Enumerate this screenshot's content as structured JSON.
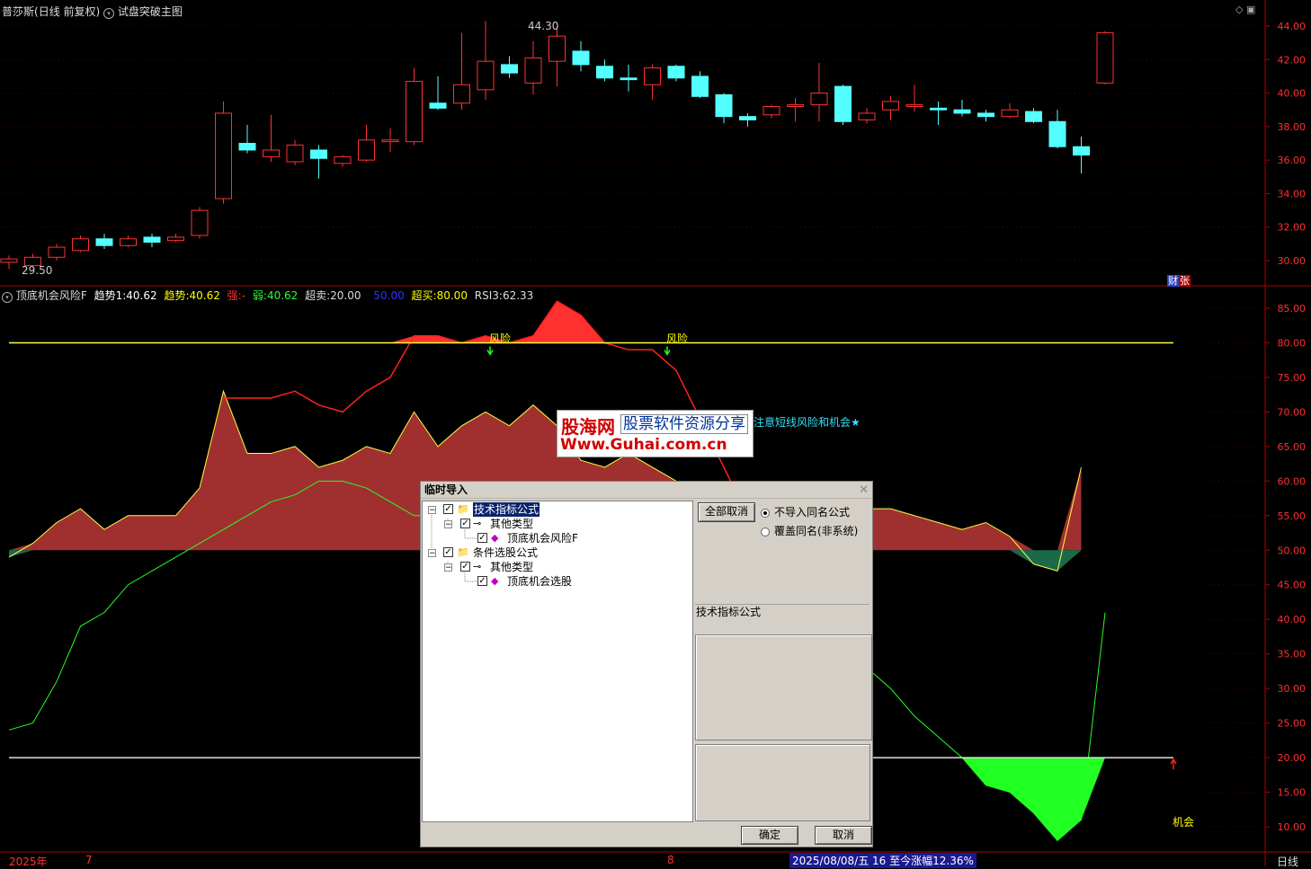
{
  "header": {
    "stock_name": "普莎斯",
    "mode": "(日线 前复权)",
    "main_indicator": "试盘突破主图"
  },
  "price_panel": {
    "high_label": "44.30",
    "low_label": "29.50",
    "yaxis_ticks": [
      "44.00",
      "42.00",
      "40.00",
      "38.00",
      "36.00",
      "34.00",
      "32.00",
      "30.00"
    ],
    "badge_left": "财",
    "badge_right": "张"
  },
  "indicator_panel": {
    "name": "顶底机会风险F",
    "trend1_label": "趋势1:",
    "trend1_value": "40.62",
    "trend_label": "趋势:",
    "trend_value": "40.62",
    "strong_label": "强:",
    "strong_value": "-",
    "weak_label": "弱:",
    "weak_value": "40.62",
    "oversold_label": "超卖:",
    "oversold_value": "20.00",
    "mid_value": "50.00",
    "overbought_label": "超买:",
    "overbought_value": "80.00",
    "rsi_label": "RSI3:",
    "rsi_value": "62.33",
    "risk_label_1": "风险",
    "risk_label_2": "风险",
    "note": "注意短线风险和机会★",
    "chance_label": "机会",
    "yaxis_ticks": [
      "85.00",
      "80.00",
      "75.00",
      "70.00",
      "65.00",
      "60.00",
      "55.00",
      "50.00",
      "45.00",
      "40.00",
      "35.00",
      "30.00",
      "25.00",
      "20.00",
      "15.00",
      "10.00"
    ]
  },
  "bottom_bar": {
    "year": "2025年",
    "mark_7": "7",
    "mark_8": "8",
    "status": "2025/08/08/五 16 至今涨幅12.36%",
    "period": "日线"
  },
  "watermark": {
    "line1": "股海网",
    "line2": "股票软件资源分享",
    "line3": "Www.Guhai.com.cn"
  },
  "dialog": {
    "title": "临时导入",
    "tree": [
      {
        "label": "技术指标公式",
        "level": 0,
        "checked": true,
        "selected": true
      },
      {
        "label": "其他类型",
        "level": 1,
        "checked": true
      },
      {
        "label": "顶底机会风险F",
        "level": 2,
        "checked": true
      },
      {
        "label": "条件选股公式",
        "level": 0,
        "checked": true
      },
      {
        "label": "其他类型",
        "level": 1,
        "checked": true
      },
      {
        "label": "顶底机会选股",
        "level": 2,
        "checked": true
      }
    ],
    "cancel_all": "全部取消",
    "radio_no_import": "不导入同名公式",
    "radio_overwrite": "覆盖同名(非系统)",
    "type_label": "技术指标公式",
    "ok": "确定",
    "cancel": "取消"
  },
  "chart_data": {
    "type": "candlestick",
    "candles": [
      {
        "o": 29.9,
        "c": 30.1,
        "h": 30.3,
        "l": 29.5
      },
      {
        "o": 29.7,
        "c": 30.2,
        "h": 30.4,
        "l": 29.6
      },
      {
        "o": 30.2,
        "c": 30.8,
        "h": 31.0,
        "l": 30.0
      },
      {
        "o": 30.6,
        "c": 31.3,
        "h": 31.5,
        "l": 30.5
      },
      {
        "o": 31.3,
        "c": 30.9,
        "h": 31.6,
        "l": 30.7
      },
      {
        "o": 30.9,
        "c": 31.3,
        "h": 31.5,
        "l": 30.8
      },
      {
        "o": 31.4,
        "c": 31.1,
        "h": 31.6,
        "l": 30.8
      },
      {
        "o": 31.2,
        "c": 31.4,
        "h": 31.6,
        "l": 31.1
      },
      {
        "o": 31.5,
        "c": 33.0,
        "h": 33.2,
        "l": 31.3
      },
      {
        "o": 33.7,
        "c": 38.8,
        "h": 39.5,
        "l": 33.4
      },
      {
        "o": 37.0,
        "c": 36.6,
        "h": 38.1,
        "l": 36.4
      },
      {
        "o": 36.2,
        "c": 36.6,
        "h": 38.7,
        "l": 35.9
      },
      {
        "o": 35.9,
        "c": 36.9,
        "h": 37.2,
        "l": 35.7
      },
      {
        "o": 36.6,
        "c": 36.1,
        "h": 36.9,
        "l": 34.9
      },
      {
        "o": 35.8,
        "c": 36.2,
        "h": 36.3,
        "l": 35.6
      },
      {
        "o": 36.0,
        "c": 37.2,
        "h": 38.1,
        "l": 35.9
      },
      {
        "o": 37.1,
        "c": 37.2,
        "h": 37.9,
        "l": 36.5
      },
      {
        "o": 37.1,
        "c": 40.7,
        "h": 41.5,
        "l": 36.9
      },
      {
        "o": 39.4,
        "c": 39.1,
        "h": 41.0,
        "l": 39.0
      },
      {
        "o": 39.4,
        "c": 40.5,
        "h": 43.6,
        "l": 39.0
      },
      {
        "o": 40.2,
        "c": 41.9,
        "h": 44.3,
        "l": 39.6
      },
      {
        "o": 41.7,
        "c": 41.2,
        "h": 42.2,
        "l": 40.9
      },
      {
        "o": 40.6,
        "c": 42.1,
        "h": 43.1,
        "l": 39.9
      },
      {
        "o": 41.9,
        "c": 43.4,
        "h": 44.0,
        "l": 40.4
      },
      {
        "o": 42.5,
        "c": 41.7,
        "h": 43.1,
        "l": 41.3
      },
      {
        "o": 41.6,
        "c": 40.9,
        "h": 42.0,
        "l": 40.7
      },
      {
        "o": 40.9,
        "c": 40.8,
        "h": 41.7,
        "l": 40.1
      },
      {
        "o": 40.5,
        "c": 41.5,
        "h": 41.7,
        "l": 39.6
      },
      {
        "o": 41.6,
        "c": 40.9,
        "h": 41.7,
        "l": 40.7
      },
      {
        "o": 41.0,
        "c": 39.8,
        "h": 41.3,
        "l": 39.7
      },
      {
        "o": 39.9,
        "c": 38.6,
        "h": 40.0,
        "l": 38.2
      },
      {
        "o": 38.6,
        "c": 38.4,
        "h": 38.8,
        "l": 38.0
      },
      {
        "o": 38.7,
        "c": 39.2,
        "h": 39.3,
        "l": 38.5
      },
      {
        "o": 39.2,
        "c": 39.3,
        "h": 39.7,
        "l": 38.3
      },
      {
        "o": 39.3,
        "c": 40.0,
        "h": 41.8,
        "l": 38.3
      },
      {
        "o": 40.4,
        "c": 38.3,
        "h": 40.5,
        "l": 38.1
      },
      {
        "o": 38.4,
        "c": 38.8,
        "h": 39.1,
        "l": 38.2
      },
      {
        "o": 39.0,
        "c": 39.5,
        "h": 39.8,
        "l": 38.4
      },
      {
        "o": 39.2,
        "c": 39.3,
        "h": 40.5,
        "l": 38.9
      },
      {
        "o": 39.1,
        "c": 39.0,
        "h": 39.5,
        "l": 38.1
      },
      {
        "o": 39.0,
        "c": 38.8,
        "h": 39.6,
        "l": 38.6
      },
      {
        "o": 38.8,
        "c": 38.6,
        "h": 39.0,
        "l": 38.3
      },
      {
        "o": 38.6,
        "c": 39.0,
        "h": 39.4,
        "l": 38.5
      },
      {
        "o": 38.9,
        "c": 38.3,
        "h": 39.1,
        "l": 38.2
      },
      {
        "o": 38.3,
        "c": 36.8,
        "h": 39.0,
        "l": 36.7
      },
      {
        "o": 36.8,
        "c": 36.3,
        "h": 37.4,
        "l": 35.2
      },
      {
        "o": 40.6,
        "c": 43.6,
        "h": 43.7,
        "l": 40.5
      }
    ],
    "indicator": {
      "level_high": 80,
      "level_mid": 50,
      "level_low": 20,
      "rsi": [
        49,
        51,
        54,
        56,
        53,
        55,
        55,
        55,
        59,
        73,
        64,
        64,
        65,
        62,
        63,
        65,
        64,
        70,
        65,
        68,
        70,
        68,
        71,
        68,
        63,
        62,
        64,
        62,
        60,
        59,
        58,
        57,
        56,
        55,
        55,
        54,
        56,
        56,
        55,
        54,
        53,
        54,
        52,
        48,
        47,
        62
      ],
      "strong": [
        null,
        null,
        null,
        null,
        null,
        null,
        null,
        null,
        null,
        72,
        72,
        72,
        73,
        71,
        70,
        73,
        75,
        81,
        81,
        80,
        81,
        80,
        81,
        86,
        84,
        80,
        79,
        79,
        76,
        69,
        62,
        55,
        50,
        null,
        null,
        null,
        null,
        null,
        null,
        null,
        null,
        null,
        null,
        null,
        null,
        null
      ],
      "weak": [
        24,
        25,
        31,
        39,
        41,
        45,
        47,
        49,
        51,
        53,
        55,
        57,
        58,
        60,
        60,
        59,
        57,
        55,
        55,
        55,
        54,
        53,
        52,
        52,
        52,
        51,
        51,
        51,
        50,
        50,
        49,
        48,
        47,
        45,
        41,
        37,
        33,
        30,
        26,
        23,
        20,
        16,
        15,
        12,
        8,
        11,
        41
      ]
    }
  }
}
